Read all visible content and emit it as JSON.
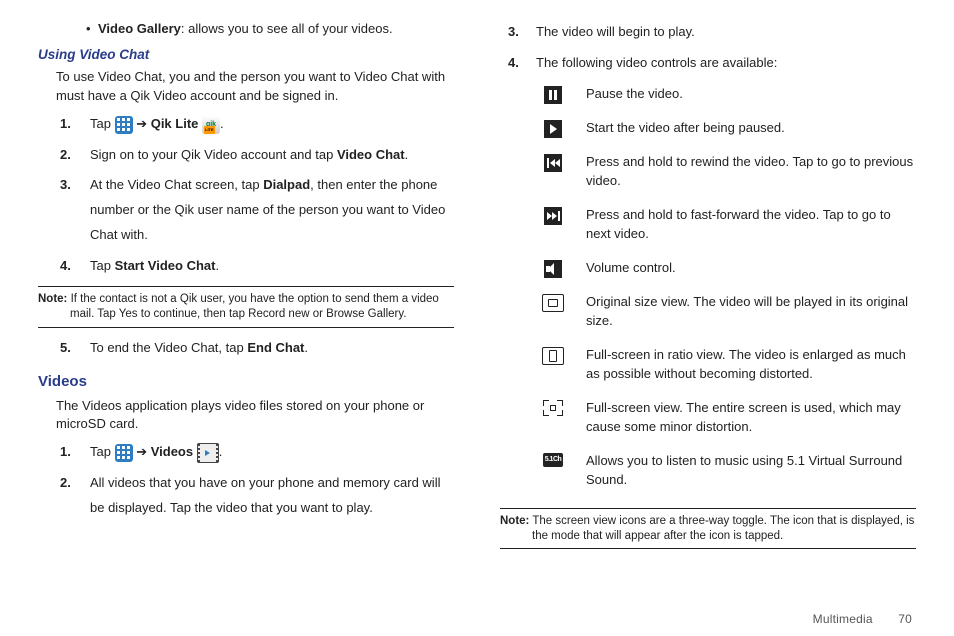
{
  "left": {
    "bullet": {
      "label": "Video Gallery",
      "desc": ": allows you to see all of your videos."
    },
    "h1": "Using Video Chat",
    "intro": "To use Video Chat, you and the person you want to Video Chat with must have a Qik Video account and be signed in.",
    "s1": {
      "num": "1.",
      "a": "Tap ",
      "b": " ➔ ",
      "c": "Qik Lite ",
      "d": "."
    },
    "s2": {
      "num": "2.",
      "a": "Sign on to your Qik Video account and tap ",
      "b": "Video Chat",
      "c": "."
    },
    "s3": {
      "num": "3.",
      "a": "At the Video Chat screen, tap ",
      "b": "Dialpad",
      "c": ", then enter the phone number or the Qik user name of the person you want to Video Chat with."
    },
    "s4": {
      "num": "4.",
      "a": "Tap ",
      "b": "Start Video Chat",
      "c": "."
    },
    "note": {
      "label": "Note:",
      "body": " If the contact is not a Qik user, you have the option to send them a video mail. Tap Yes to continue, then tap Record new or Browse Gallery."
    },
    "s5": {
      "num": "5.",
      "a": "To end the Video Chat, tap ",
      "b": "End Chat",
      "c": "."
    },
    "h2": "Videos",
    "intro2": "The Videos application plays video files stored on your phone or microSD card.",
    "v1": {
      "num": "1.",
      "a": "Tap ",
      "b": " ➔ ",
      "c": "Videos ",
      "d": "."
    },
    "v2": {
      "num": "2.",
      "a": "All videos that you have on your phone and memory card will be displayed. Tap the video that you want to play."
    }
  },
  "right": {
    "r3": {
      "num": "3.",
      "a": "The video will begin to play."
    },
    "r4": {
      "num": "4.",
      "a": "The following video controls are available:"
    },
    "controls": [
      {
        "text": "Pause the video."
      },
      {
        "text": "Start the video after being paused."
      },
      {
        "text": "Press and hold to rewind the video. Tap to go to previous video."
      },
      {
        "text": "Press and hold to fast-forward the video. Tap to go to next video."
      },
      {
        "text": "Volume control."
      },
      {
        "text": "Original size view. The video will be played in its original size."
      },
      {
        "text": "Full-screen in ratio view. The video is enlarged as much as possible without becoming distorted."
      },
      {
        "text": "Full-screen view. The entire screen is used, which may cause some minor distortion."
      },
      {
        "text": "Allows you to listen to music using 5.1 Virtual Surround Sound."
      }
    ],
    "note": {
      "label": "Note:",
      "body": " The screen view icons are a three-way toggle. The icon that is displayed, is the mode that will appear after the icon is tapped."
    }
  },
  "footer": {
    "section": "Multimedia",
    "page": "70"
  }
}
